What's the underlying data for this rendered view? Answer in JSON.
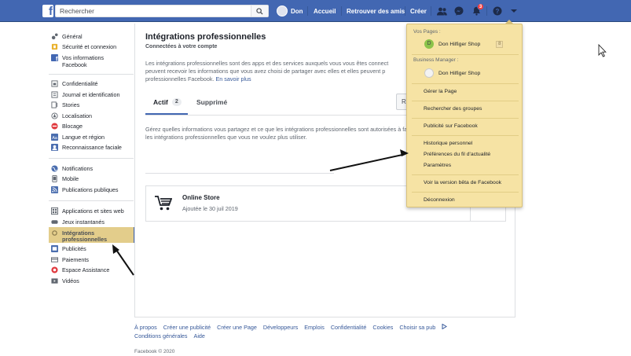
{
  "topbar": {
    "logo": "f",
    "search_placeholder": "Rechercher",
    "user_name": "Don",
    "home": "Accueil",
    "find_friends": "Retrouver des amis",
    "create": "Créer",
    "notifications_count": "3",
    "brand_color": "#4267b2"
  },
  "leftnav": {
    "items": [
      {
        "label": "Général",
        "icon": "gear-icon"
      },
      {
        "label": "Sécurité et connexion",
        "icon": "shield-icon"
      },
      {
        "label": "Vos informations",
        "icon": "facebook-icon"
      },
      {
        "label": "Facebook",
        "icon": ""
      },
      {
        "label": "Confidentialité",
        "icon": "lock-icon"
      },
      {
        "label": "Journal et identification",
        "icon": "journal-icon"
      },
      {
        "label": "Stories",
        "icon": "stories-icon"
      },
      {
        "label": "Localisation",
        "icon": "location-icon"
      },
      {
        "label": "Blocage",
        "icon": "block-icon"
      },
      {
        "label": "Langue et région",
        "icon": "language-icon"
      },
      {
        "label": "Reconnaissance faciale",
        "icon": "face-icon"
      },
      {
        "label": "Notifications",
        "icon": "globe-icon"
      },
      {
        "label": "Mobile",
        "icon": "mobile-icon"
      },
      {
        "label": "Publications publiques",
        "icon": "rss-icon"
      },
      {
        "label": "Applications et sites web",
        "icon": "apps-icon"
      },
      {
        "label": "Jeux instantanés",
        "icon": "games-icon"
      },
      {
        "label": "Intégrations",
        "icon": "integrations-icon"
      },
      {
        "label": "professionnelles",
        "icon": ""
      },
      {
        "label": "Publicités",
        "icon": "ads-icon"
      },
      {
        "label": "Paiements",
        "icon": "payments-icon"
      },
      {
        "label": "Espace Assistance",
        "icon": "support-icon"
      },
      {
        "label": "Vidéos",
        "icon": "video-icon"
      }
    ]
  },
  "main": {
    "title": "Intégrations professionnelles",
    "subtitle": "Connectées à votre compte",
    "description_1": "Les intégrations professionnelles sont des apps et des services auxquels vous vous êtes connect",
    "description_2": "peuvent recevoir les informations que vous avez choisi de partager avec elles et elles peuvent p",
    "description_3": "professionnelles Facebook.",
    "learn_more": "En savoir plus",
    "tab_active": "Actif",
    "tab_active_count": "2",
    "tab_removed": "Supprimé",
    "search_stub": "R",
    "help_1": "Gérez quelles informations vous partagez et ce que les intégrations professionnelles sont autorisées à fa",
    "help_2": "les intégrations professionnelles que vous ne voulez plus utiliser.",
    "integration": {
      "name": "Online Store",
      "added": "Ajoutée le 30 juil 2019"
    }
  },
  "dropdown": {
    "pages_header": "Vos Pages :",
    "page_name": "Don Hilfiger Shop",
    "page_initial": "D",
    "page_badge": "8",
    "bm_header": "Business Manager :",
    "bm_name": "Don Hilfiger Shop",
    "manage_page": "Gérer la Page",
    "manage_groups": "Rechercher des groupes",
    "advertise": "Publicité sur Facebook",
    "activity_log": "Historique personnel",
    "news_feed_prefs": "Préférences du fil d'actualité",
    "settings": "Paramètres",
    "beta": "Voir la version bêta de Facebook",
    "logout": "Déconnexion",
    "highlight_color": "#f6e3a4"
  },
  "footer": {
    "links": [
      "À propos",
      "Créer une publicité",
      "Créer une Page",
      "Développeurs",
      "Emplois",
      "Confidentialité",
      "Cookies",
      "Choisir sa pub"
    ],
    "links2": [
      "Conditions générales",
      "Aide"
    ],
    "copyright": "Facebook © 2020"
  }
}
